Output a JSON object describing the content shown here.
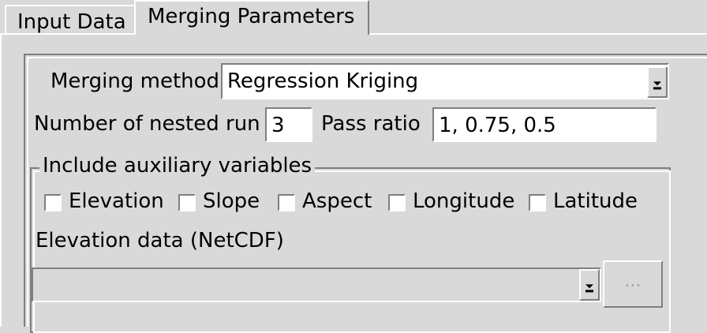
{
  "tabs": {
    "input_data": "Input Data",
    "merging_parameters": "Merging Parameters"
  },
  "form": {
    "merging_method_label": "Merging method",
    "merging_method_value": "Regression Kriging",
    "nested_run_label": "Number of nested run",
    "nested_run_value": "3",
    "pass_ratio_label": "Pass ratio",
    "pass_ratio_value": "1, 0.75, 0.5"
  },
  "aux": {
    "group_title": "Include auxiliary variables",
    "checkboxes": [
      {
        "label": "Elevation",
        "checked": false
      },
      {
        "label": "Slope",
        "checked": false
      },
      {
        "label": "Aspect",
        "checked": false
      },
      {
        "label": "Longitude",
        "checked": false
      },
      {
        "label": "Latitude",
        "checked": false
      }
    ],
    "elevation_data_label": "Elevation data (NetCDF)",
    "elevation_data_value": "",
    "browse_label": "..."
  }
}
